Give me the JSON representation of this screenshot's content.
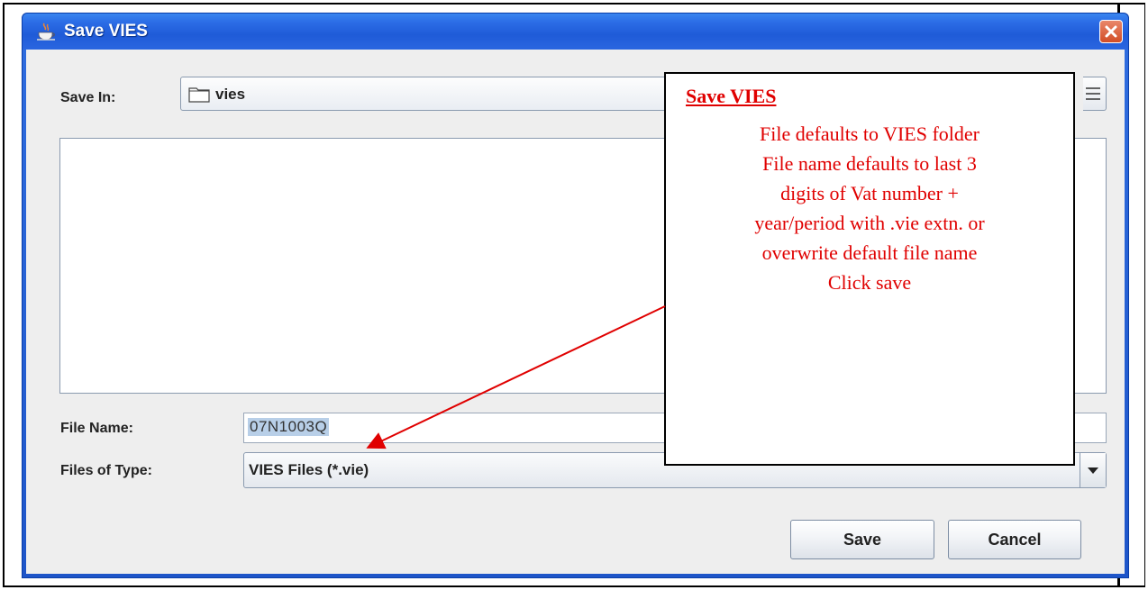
{
  "dialog": {
    "title": "Save VIES",
    "save_in_label": "Save In:",
    "save_in_value": "vies",
    "file_name_label": "File Name:",
    "file_name_value": "07N1003Q",
    "files_of_type_label": "Files of Type:",
    "files_of_type_value": "VIES Files (*.vie)",
    "save_button": "Save",
    "cancel_button": "Cancel"
  },
  "annotation": {
    "title": "Save VIES",
    "lines": [
      "File defaults to VIES folder",
      "File name defaults to last 3",
      "digits of Vat number +",
      "year/period with .vie extn. or",
      "overwrite default file name",
      "Click save"
    ]
  },
  "colors": {
    "titlebar": "#2b6ce6",
    "annotation_text": "#e00000"
  },
  "icons": {
    "title_icon": "java-cup-icon",
    "close_icon": "close-icon",
    "folder_icon": "folder-icon",
    "view_icon": "details-view-icon",
    "dropdown_icon": "chevron-down-icon"
  }
}
